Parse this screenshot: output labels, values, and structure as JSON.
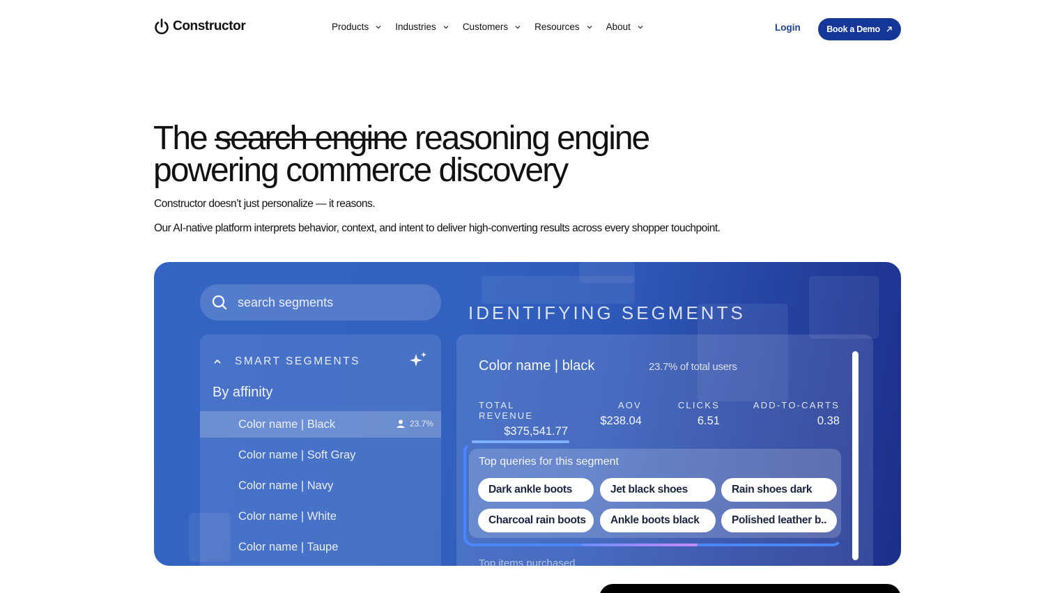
{
  "brand": {
    "name": "Constructor"
  },
  "nav": {
    "items": [
      {
        "label": "Products"
      },
      {
        "label": "Industries"
      },
      {
        "label": "Customers"
      },
      {
        "label": "Resources"
      },
      {
        "label": "About"
      }
    ],
    "login_label": "Login",
    "demo_label": "Book a Demo"
  },
  "hero": {
    "headline_prefix": "The",
    "headline_struck": "search engine",
    "headline_suffix": "reasoning engine",
    "headline_line2": "powering commerce discovery",
    "subtitle_1": "Constructor doesn’t just personalize — it reasons.",
    "subtitle_2": "Our AI-native platform interprets behavior, context, and intent to deliver high-converting results across every shopper touchpoint."
  },
  "media": {
    "search_placeholder": "search segments",
    "panel_title": "IDENTIFYING SEGMENTS",
    "smart_segments_label": "SMART SEGMENTS",
    "group_label": "By affinity",
    "segments": [
      {
        "label": "Color name | Black",
        "pct": "23.7%"
      },
      {
        "label": "Color name | Soft Gray"
      },
      {
        "label": "Color name | Navy"
      },
      {
        "label": "Color name | White"
      },
      {
        "label": "Color name | Taupe"
      }
    ],
    "detail": {
      "title": "Color name | black",
      "share": "23.7% of total users",
      "metrics": [
        {
          "label": "TOTAL REVENUE",
          "value": "$375,541.77"
        },
        {
          "label": "AOV",
          "value": "$238.04"
        },
        {
          "label": "CLICKS",
          "value": "6.51"
        },
        {
          "label": "ADD-TO-CARTS",
          "value": "0.38"
        }
      ],
      "queries_title": "Top queries for this segment",
      "queries": [
        "Dark ankle boots",
        "Jet black shoes",
        "Rain shoes dark",
        "Charcoal rain boots",
        "Ankle boots black",
        "Polished leather b.."
      ],
      "top_items_label": "Top items purchased"
    }
  }
}
